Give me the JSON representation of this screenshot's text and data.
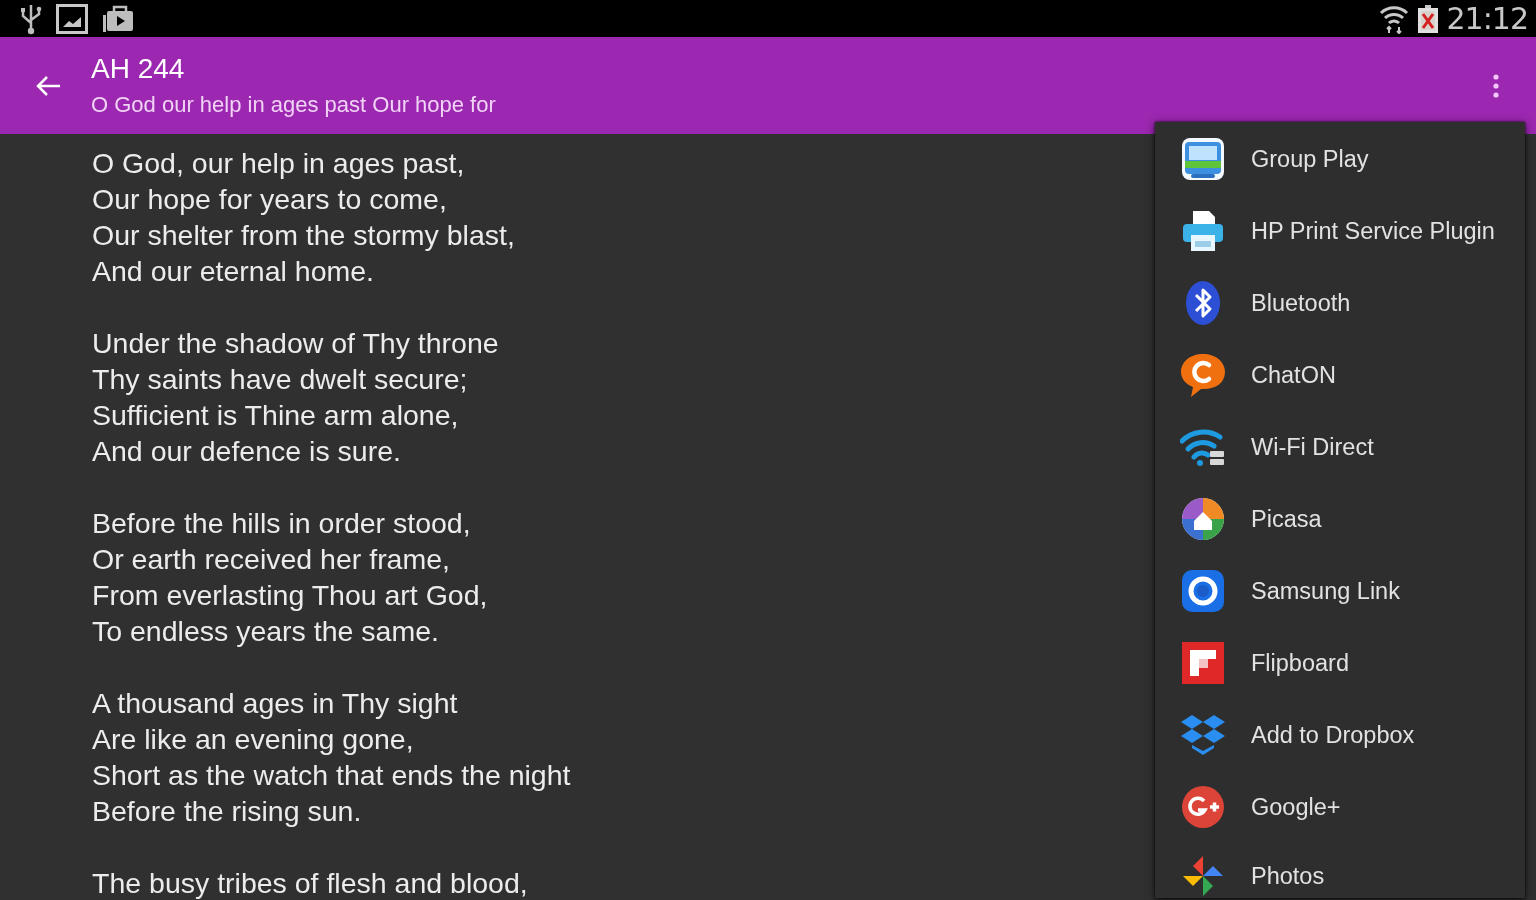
{
  "status_bar": {
    "time": "21:12"
  },
  "toolbar": {
    "title": "AH 244",
    "subtitle": "O God our help in ages past Our hope for"
  },
  "lyrics": {
    "stanzas": [
      [
        "O God, our help in ages past,",
        "Our hope for years to come,",
        "Our shelter from the stormy blast,",
        "And our eternal home."
      ],
      [
        "Under the shadow of Thy throne",
        "Thy saints have dwelt secure;",
        "Sufficient is Thine arm alone,",
        "And our defence is sure."
      ],
      [
        "Before the hills in order stood,",
        "Or earth received her frame,",
        "From everlasting Thou art God,",
        "To endless years the same."
      ],
      [
        "A thousand ages in Thy sight",
        "Are like an evening gone,",
        "Short as the watch that ends the night",
        "Before the rising sun."
      ],
      [
        "The busy tribes of flesh and blood,"
      ]
    ]
  },
  "share_menu": {
    "items": [
      {
        "label": "Group Play"
      },
      {
        "label": "HP Print Service Plugin"
      },
      {
        "label": "Bluetooth"
      },
      {
        "label": "ChatON"
      },
      {
        "label": "Wi-Fi Direct"
      },
      {
        "label": "Picasa"
      },
      {
        "label": "Samsung Link"
      },
      {
        "label": "Flipboard"
      },
      {
        "label": "Add to Dropbox"
      },
      {
        "label": "Google+"
      },
      {
        "label": "Photos"
      }
    ]
  }
}
